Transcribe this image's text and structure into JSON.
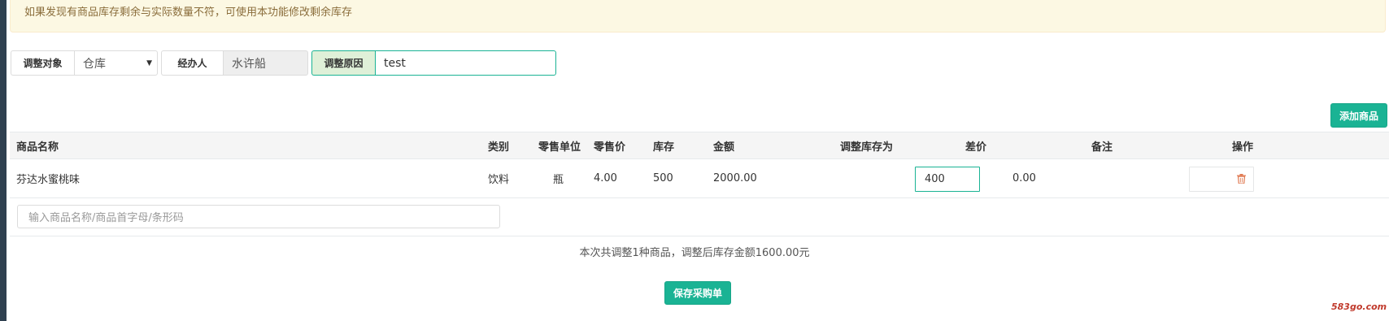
{
  "notice": "如果发现有商品库存剩余与实际数量不符，可使用本功能修改剩余库存",
  "form": {
    "target_label": "调整对象",
    "target_value": "仓库",
    "handler_label": "经办人",
    "handler_value": "水许船",
    "reason_label": "调整原因",
    "reason_value": "test"
  },
  "add_button": "添加商品",
  "table": {
    "headers": [
      "商品名称",
      "类别",
      "零售单位",
      "零售价",
      "库存",
      "金额",
      "调整库存为",
      "差价",
      "备注",
      "操作"
    ],
    "rows": [
      {
        "name": "芬达水蜜桃味",
        "category": "饮料",
        "unit": "瓶",
        "price": "4.00",
        "stock": "500",
        "amount": "2000.00",
        "adjust_to": "400",
        "diff": "0.00",
        "note": "",
        "action_icon": "trash-icon"
      }
    ]
  },
  "search_placeholder": "输入商品名称/商品首字母/条形码",
  "summary": "本次共调整1种商品，调整后库存金额1600.00元",
  "save_button": "保存采购单",
  "watermark": "583go.com",
  "colors": {
    "accent": "#1ab394",
    "notice_bg": "#fcf8e3",
    "notice_text": "#8a6d3b",
    "trash": "#e07b53"
  }
}
